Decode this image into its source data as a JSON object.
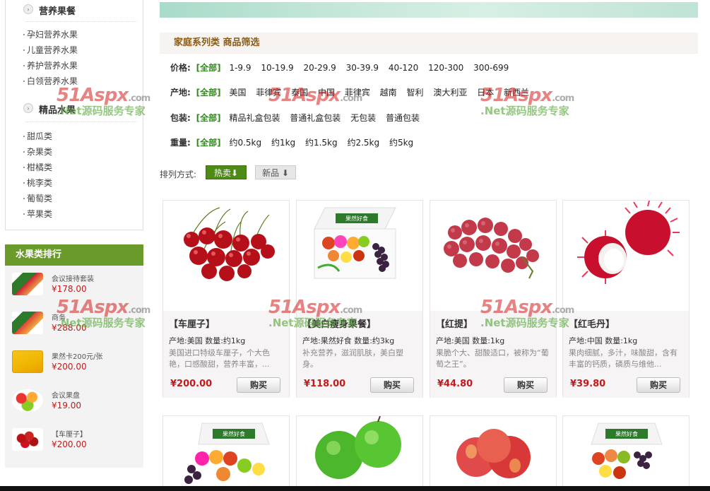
{
  "sidebar": {
    "category1": {
      "title": "营养果餐",
      "items": [
        "孕妇营养水果",
        "儿童营养水果",
        "养护营养水果",
        "白领营养水果"
      ]
    },
    "category2": {
      "title": "精品水果",
      "items": [
        "甜瓜类",
        "杂果类",
        "柑橘类",
        "桃李类",
        "葡萄类",
        "苹果类"
      ]
    },
    "ranking": {
      "title": "水果类排行",
      "items": [
        {
          "name": "会议接待套装",
          "price": "¥178.00"
        },
        {
          "name": "商务",
          "price": "¥288.00"
        },
        {
          "name": "果然卡200元/张",
          "price": "¥200.00"
        },
        {
          "name": "会议果盘",
          "price": "¥19.00"
        },
        {
          "name": "【车厘子】",
          "price": "¥200.00"
        }
      ]
    }
  },
  "filter": {
    "title": "家庭系列类 商品筛选",
    "price": {
      "label": "价格:",
      "all": "[全部]",
      "options": [
        "1-9.9",
        "10-19.9",
        "20-29.9",
        "30-39.9",
        "40-120",
        "120-300",
        "300-699"
      ]
    },
    "origin": {
      "label": "产地:",
      "all": "[全部]",
      "options": [
        "美国",
        "菲律宾",
        "泰国",
        "中国",
        "菲律宾",
        "越南",
        "智利",
        "澳大利亚",
        "日本",
        "新西兰"
      ]
    },
    "package": {
      "label": "包装:",
      "all": "[全部]",
      "options": [
        "精品礼盒包装",
        "普通礼盒包装",
        "无包装",
        "普通包装"
      ]
    },
    "weight": {
      "label": "重量:",
      "all": "[全部]",
      "options": [
        "约0.5kg",
        "约1kg",
        "约1.5kg",
        "约2.5kg",
        "约5kg"
      ]
    }
  },
  "sort": {
    "label": "排列方式:",
    "hot": "热卖⬇",
    "new": "新品 ⬇"
  },
  "products": [
    {
      "name": "【车厘子】",
      "meta": "产地:美国 数量:约1kg",
      "desc": "美国进口特级车厘子，个大色艳，口感酸甜，营养丰富，...",
      "price": "¥200.00",
      "buy": "购买"
    },
    {
      "name": "【美白瘦身果餐】",
      "meta": "产地:果然好食 数量:约3kg",
      "desc": "补充营养，滋润肌肤，美白塑身。",
      "price": "¥118.00",
      "buy": "购买"
    },
    {
      "name": "【红提】",
      "meta": "产地:美国 数量:1kg",
      "desc": "果脆个大、甜酸适口，被称为“葡萄之王”。",
      "price": "¥44.80",
      "buy": "购买"
    },
    {
      "name": "【红毛丹】",
      "meta": "产地:中国 数量:1kg",
      "desc": "果肉细腻，多汁，味酸甜，含有丰富的钙质，磷质与维他...",
      "price": "¥39.80",
      "buy": "购买"
    }
  ],
  "box_label": "果然好食",
  "watermark": {
    "brand": "51Aspx",
    "domain": ".com",
    "slogan": ".Net源码服务专家"
  },
  "colors": {
    "accent_green": "#4e8b14",
    "price_red": "#c4191a",
    "rank_head": "#6a9a2a"
  }
}
